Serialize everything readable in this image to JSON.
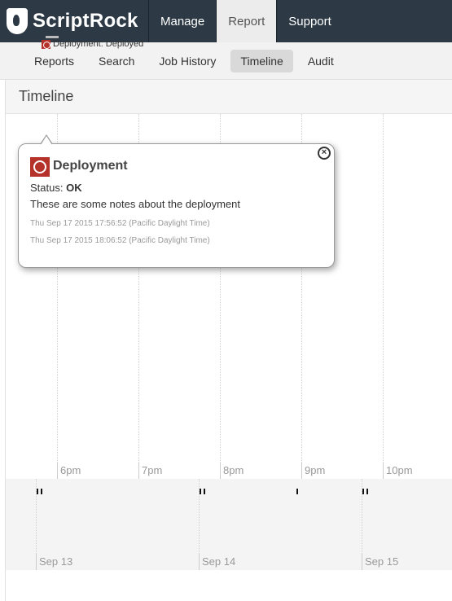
{
  "brand": {
    "name": "ScriptRock"
  },
  "topnav": [
    "Manage",
    "Report",
    "Support"
  ],
  "subnav": [
    "Reports",
    "Search",
    "Job History",
    "Timeline",
    "Audit"
  ],
  "panel": {
    "title": "Timeline"
  },
  "timeline": {
    "hours": [
      "6pm",
      "7pm",
      "8pm",
      "9pm",
      "10pm"
    ],
    "days": [
      "Sep 13",
      "Sep 14",
      "Sep 15"
    ],
    "event_label": "Deployment: Deployed"
  },
  "popup": {
    "title": "Deployment",
    "status_label": "Status:",
    "status_value": "OK",
    "notes": "These are some notes about the deployment",
    "time_start": "Thu Sep 17 2015 17:56:52 (Pacific Daylight Time)",
    "time_end": "Thu Sep 17 2015 18:06:52 (Pacific Daylight Time)",
    "close_icon": "close-icon"
  },
  "colors": {
    "topbar": "#2d3a46",
    "accent": "#b5322b"
  }
}
